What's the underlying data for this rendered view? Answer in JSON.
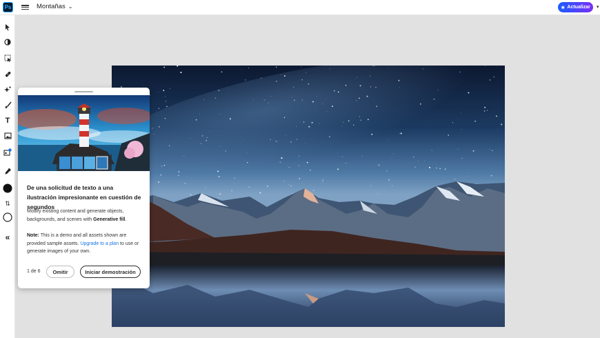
{
  "app": {
    "logo_text": "Ps",
    "document_name": "Montañas",
    "update_button": "Actualizar"
  },
  "toolbar": {
    "tools": [
      "move-tool",
      "adjust-tool",
      "select-tool",
      "heal-tool",
      "generative-tool",
      "brush-tool",
      "type-tool",
      "place-image-tool",
      "generate-image-tool",
      "eyedropper-tool",
      "foreground-color",
      "swap-colors",
      "background-color",
      "collapse-toolbar"
    ]
  },
  "onboarding": {
    "title": "De una solicitud de texto a una ilustración impresionante en cuestión de segundos",
    "description_prefix": "Modify existing content and generate objects, backgrounds, and scenes with ",
    "description_bold": "Generative fill",
    "description_suffix": ".",
    "note_label": "Note:",
    "note_text": " This is a demo and all assets shown are provided sample assets. ",
    "note_link": "Upgrade to a plan",
    "note_suffix": " to use or generate images of your own.",
    "pager": "1 de 6",
    "skip_button": "Omitir",
    "start_button": "Iniciar demostración"
  },
  "colors": {
    "accent_blue": "#1473e6",
    "update_gradient_start": "#1a5cff",
    "update_gradient_end": "#7b2ff7",
    "canvas_background": "#e1e1e1"
  }
}
